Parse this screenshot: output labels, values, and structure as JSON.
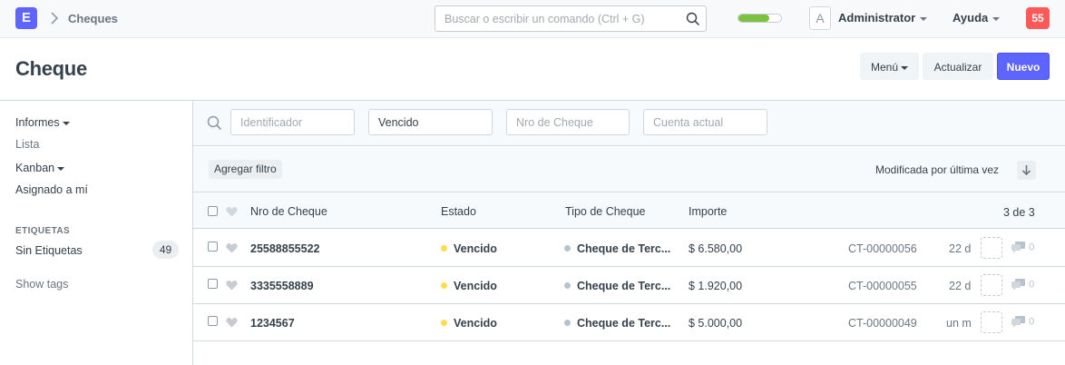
{
  "navbar": {
    "logo_letter": "E",
    "breadcrumb": "Cheques",
    "search_placeholder": "Buscar o escribir un comando (Ctrl + G)",
    "progress_fraction": 0.72,
    "avatar_letter": "A",
    "user_name": "Administrator",
    "help_label": "Ayuda",
    "notification_count": "55"
  },
  "page": {
    "title": "Cheque",
    "menu_label": "Menú",
    "refresh_label": "Actualizar",
    "new_label": "Nuevo"
  },
  "sidebar": {
    "items": [
      {
        "label": "Informes"
      },
      {
        "label": "Lista"
      },
      {
        "label": "Kanban"
      },
      {
        "label": "Asignado a mí"
      }
    ],
    "tags_heading": "ETIQUETAS",
    "no_tags_label": "Sin Etiquetas",
    "no_tags_count": "49",
    "show_tags_label": "Show tags"
  },
  "filters": {
    "id_placeholder": "Identificador",
    "estado_value": "Vencido",
    "nro_placeholder": "Nro de Cheque",
    "cuenta_placeholder": "Cuenta actual",
    "add_filter_label": "Agregar filtro",
    "sort_label": "Modificada por última vez"
  },
  "list": {
    "columns": [
      "Nro de Cheque",
      "Estado",
      "Tipo de Cheque",
      "Importe"
    ],
    "count_label": "3 de 3",
    "rows": [
      {
        "nro": "25588855522",
        "estado": "Vencido",
        "tipo": "Cheque de Terc...",
        "importe": "$ 6.580,00",
        "name": "CT-00000056",
        "modified": "22 d",
        "comments": "0"
      },
      {
        "nro": "3335558889",
        "estado": "Vencido",
        "tipo": "Cheque de Terc...",
        "importe": "$ 1.920,00",
        "name": "CT-00000055",
        "modified": "22 d",
        "comments": "0"
      },
      {
        "nro": "1234567",
        "estado": "Vencido",
        "tipo": "Cheque de Terc...",
        "importe": "$ 5.000,00",
        "name": "CT-00000049",
        "modified": "un m",
        "comments": "0"
      }
    ]
  },
  "colors": {
    "primary": "#5e64ff",
    "notification": "#ff5858",
    "status_vencido": "#ffdc4e",
    "progress": "#7cc242"
  }
}
